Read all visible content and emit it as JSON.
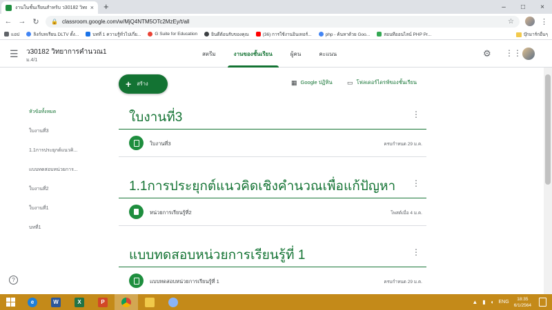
{
  "browser": {
    "tab_title": "งานในชั้นเรียนสำหรับ ว30182 วิทยาการ",
    "tab_close": "×",
    "new_tab": "+",
    "url": "classroom.google.com/w/MjQ4NTM5OTc2MzEy/t/all",
    "window_controls": [
      "–",
      "□",
      "×"
    ]
  },
  "bookmarks": {
    "items": [
      {
        "label": "แอป",
        "color": "#5f6368"
      },
      {
        "label": "ลิงก์บทเรียน DLTV ตั้ง...",
        "color": "#4285f4"
      },
      {
        "label": "บทที่ 1 ความรู้ทั่วไปเกี่ย...",
        "color": "#1a73e8"
      },
      {
        "label": "G Suite for Education",
        "color": "#ea4335"
      },
      {
        "label": "ยินดีต้อนรับของคุณ",
        "color": "#3c4043"
      },
      {
        "label": "(36) การใช้งานอินเทอร์...",
        "color": "#ff0000"
      },
      {
        "label": "php - ค้นหาด้วย Goo...",
        "color": "#4285f4"
      },
      {
        "label": "สอนทีออนไลน์ PHP Pr...",
        "color": "#34a853"
      }
    ],
    "other": "บุ๊กมาร์กอื่นๆ"
  },
  "classroom": {
    "class_title": "ว30182 วิทยาการคำนวณ1",
    "class_section": "ม.4/1",
    "tabs": [
      {
        "label": "สตรีม",
        "active": false
      },
      {
        "label": "งานของชั้นเรียน",
        "active": true
      },
      {
        "label": "ผู้คน",
        "active": false
      },
      {
        "label": "คะแนน",
        "active": false
      }
    ]
  },
  "sidebar": {
    "items": [
      {
        "label": "หัวข้อทั้งหมด",
        "active": true
      },
      {
        "label": "ใบงานที่3",
        "active": false
      },
      {
        "label": "1.1การประยุกต์แนวคิ...",
        "active": false
      },
      {
        "label": "แบบทดสอบหน่วยการ...",
        "active": false
      },
      {
        "label": "ใบงานที่2",
        "active": false
      },
      {
        "label": "ใบงานที่1",
        "active": false
      },
      {
        "label": "บทที่1",
        "active": false
      }
    ],
    "help": "?"
  },
  "actions": {
    "create": "สร้าง",
    "calendar": "Google ปฏิทิน",
    "drive_folder": "โฟลเดอร์ไดรฟ์ของชั้นเรียน"
  },
  "topics": [
    {
      "title": "ใบงานที่3",
      "item": {
        "name": "ใบงานที่3",
        "meta": "ครบกำหนด 29 ม.ค.",
        "type": "assignment"
      }
    },
    {
      "title": "1.1การประยุกต์แนวคิดเชิงคำนวณเพื่อแก้ปัญหา",
      "item": {
        "name": "หน่วยการเรียนรู้ที่2",
        "meta": "โพสต์เมื่อ 4 ม.ค.",
        "type": "material"
      }
    },
    {
      "title": "แบบทดสอบหน่วยการเรียนรู้ที่ 1",
      "item": {
        "name": "แบบทดสอบหน่วยการเรียนรู้ที่ 1",
        "meta": "ครบกำหนด 29 ม.ค.",
        "type": "assignment"
      }
    }
  ],
  "taskbar": {
    "apps": [
      {
        "name": "internet-explorer",
        "letter": "e",
        "color": "#1f7fd8"
      },
      {
        "name": "word",
        "letter": "W",
        "color": "#2b579a"
      },
      {
        "name": "excel",
        "letter": "X",
        "color": "#217346"
      },
      {
        "name": "powerpoint",
        "letter": "P",
        "color": "#d24726"
      },
      {
        "name": "chrome",
        "letter": "",
        "color": "#db4437"
      },
      {
        "name": "file-explorer",
        "letter": "",
        "color": "#f0c94a"
      },
      {
        "name": "paint",
        "letter": "",
        "color": "#8ab4f8"
      }
    ],
    "lang": "ENG",
    "time": "18:35",
    "date": "6/1/2564"
  }
}
